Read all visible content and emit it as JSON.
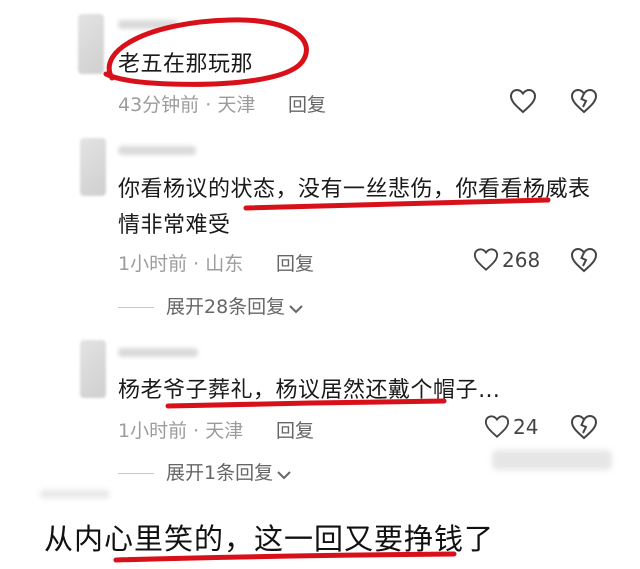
{
  "comments": [
    {
      "text": "老五在那玩那",
      "time": "43分钟前",
      "location": "天津",
      "reply_label": "回复",
      "like_count": "",
      "expand_text": ""
    },
    {
      "text_line1": "你看杨议的状态，没有一丝悲伤，你看看杨威表",
      "text_line2": "情非常难受",
      "time": "1小时前",
      "location": "山东",
      "reply_label": "回复",
      "like_count": "268",
      "expand_text": "展开28条回复"
    },
    {
      "text": "杨老爷子葬礼，杨议居然还戴个帽子…",
      "time": "1小时前",
      "location": "天津",
      "reply_label": "回复",
      "like_count": "24",
      "expand_text": "展开1条回复"
    }
  ],
  "meta_separator": "·",
  "caption": "从内心里笑的，这一回又要挣钱了",
  "colors": {
    "annotation_red": "#d8101a",
    "meta_gray": "#9c9c9c"
  }
}
